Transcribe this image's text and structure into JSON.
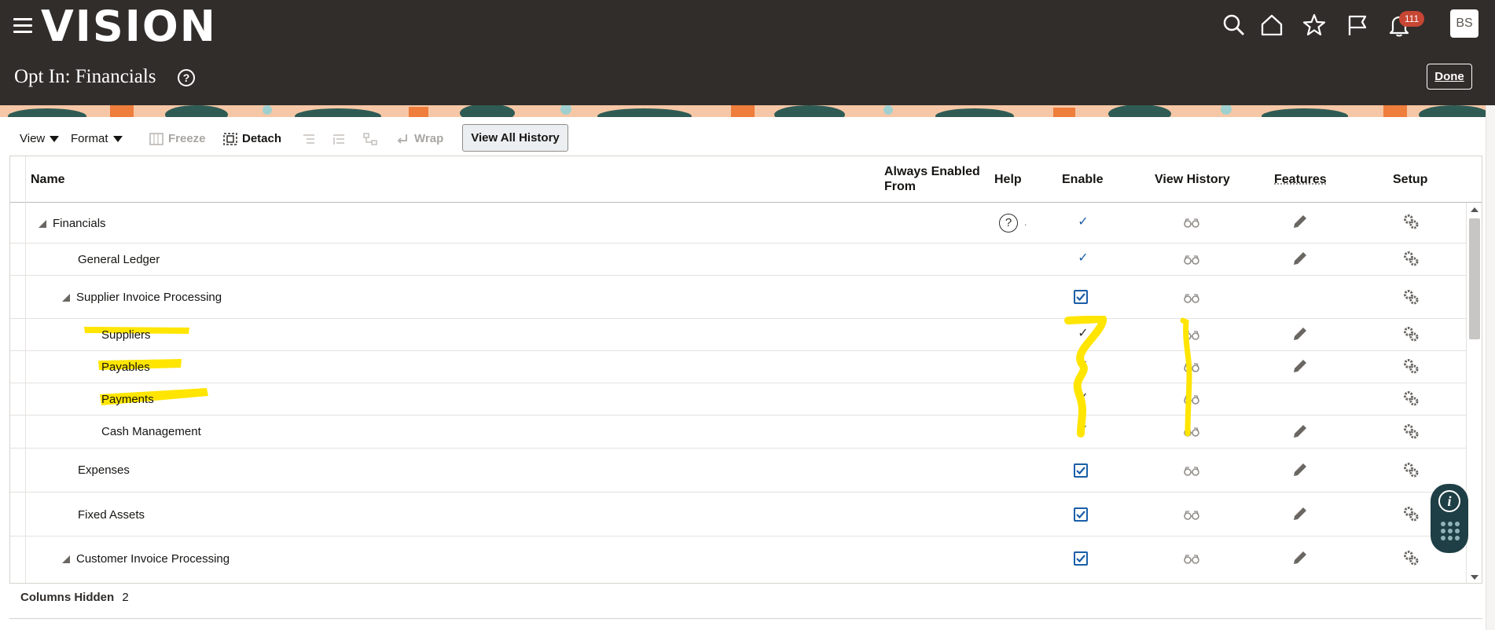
{
  "app": {
    "logo": "VISION",
    "page_title": "Opt In: Financials",
    "help_glyph": "?",
    "done_label": "Done",
    "notification_count": "111",
    "avatar_initials": "BS",
    "icons": [
      "menu-icon",
      "search-icon",
      "home-icon",
      "star-icon",
      "flag-icon",
      "bell-icon"
    ]
  },
  "toolbar": {
    "view_label": "View",
    "format_label": "Format",
    "freeze_label": "Freeze",
    "detach_label": "Detach",
    "wrap_label": "Wrap",
    "view_all_history_label": "View All History"
  },
  "table": {
    "columns": {
      "name": "Name",
      "always_enabled_line1": "Always Enabled",
      "always_enabled_line2": "From",
      "help": "Help",
      "enable": "Enable",
      "view_history": "View History",
      "features": "Features",
      "setup": "Setup"
    },
    "rows": [
      {
        "name": "Financials",
        "expandable": true,
        "enable": "check",
        "help": true,
        "features": true
      },
      {
        "name": "General Ledger",
        "expandable": false,
        "enable": "check",
        "features": true
      },
      {
        "name": "Supplier Invoice Processing",
        "expandable": true,
        "enable": "checkbox",
        "features": false
      },
      {
        "name": "Suppliers",
        "expandable": false,
        "enable": "check",
        "features": true,
        "highlighted": true
      },
      {
        "name": "Payables",
        "expandable": false,
        "enable": "check",
        "features": true,
        "highlighted": true
      },
      {
        "name": "Payments",
        "expandable": false,
        "enable": "check",
        "features": false,
        "highlighted": true
      },
      {
        "name": "Cash Management",
        "expandable": false,
        "enable": "check",
        "features": true
      },
      {
        "name": "Expenses",
        "expandable": false,
        "enable": "checkbox",
        "features": true
      },
      {
        "name": "Fixed Assets",
        "expandable": false,
        "enable": "checkbox",
        "features": true
      },
      {
        "name": "Customer Invoice Processing",
        "expandable": true,
        "enable": "checkbox",
        "features": true
      }
    ],
    "help_glyph": "?",
    "check_glyph": "✓"
  },
  "footer": {
    "columns_hidden_label": "Columns Hidden",
    "columns_hidden_count": "2"
  },
  "colors": {
    "header_bg": "#312d2a",
    "accent_blue": "#1a5ea8",
    "highlighter": "#ffe500",
    "badge": "#c74634"
  }
}
